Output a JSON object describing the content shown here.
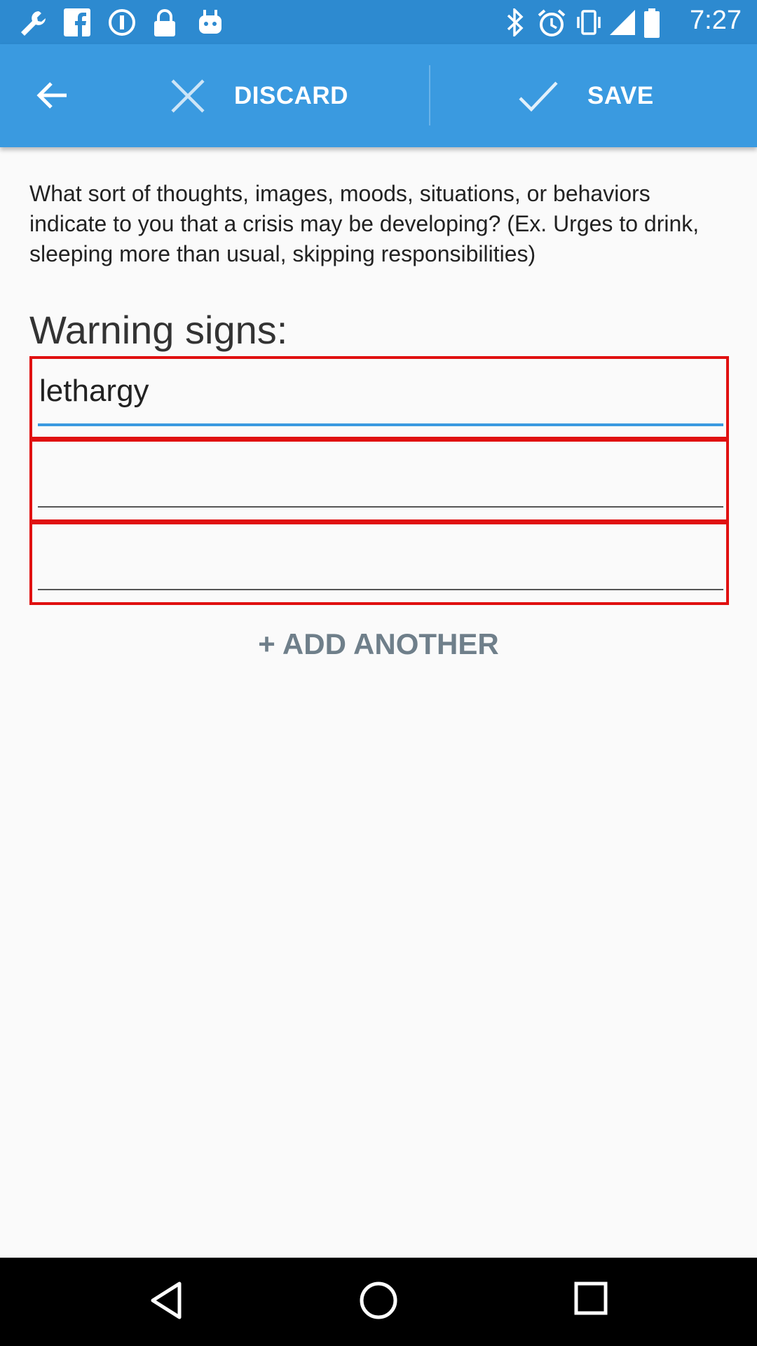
{
  "status_bar": {
    "time": "7:27",
    "left_icons": [
      "wrench-icon",
      "facebook-icon",
      "info-icon",
      "lock-icon",
      "android-icon"
    ],
    "right_icons": [
      "bluetooth-icon",
      "alarm-icon",
      "vibrate-icon",
      "signal-icon",
      "battery-icon"
    ]
  },
  "action_bar": {
    "discard_label": "DISCARD",
    "save_label": "SAVE",
    "color": "#3a9ae0"
  },
  "content": {
    "prompt": "What sort of thoughts, images, moods, situations, or behaviors indicate to you that a crisis may be developing? (Ex. Urges to drink, sleeping more than usual, skipping responsibilities)",
    "section_title": "Warning signs:",
    "fields": [
      {
        "value": "lethargy"
      },
      {
        "value": ""
      },
      {
        "value": ""
      }
    ],
    "add_another_label": "+ ADD ANOTHER"
  },
  "nav_bar": {
    "icons": [
      "back-triangle-icon",
      "home-circle-icon",
      "recents-square-icon"
    ]
  }
}
